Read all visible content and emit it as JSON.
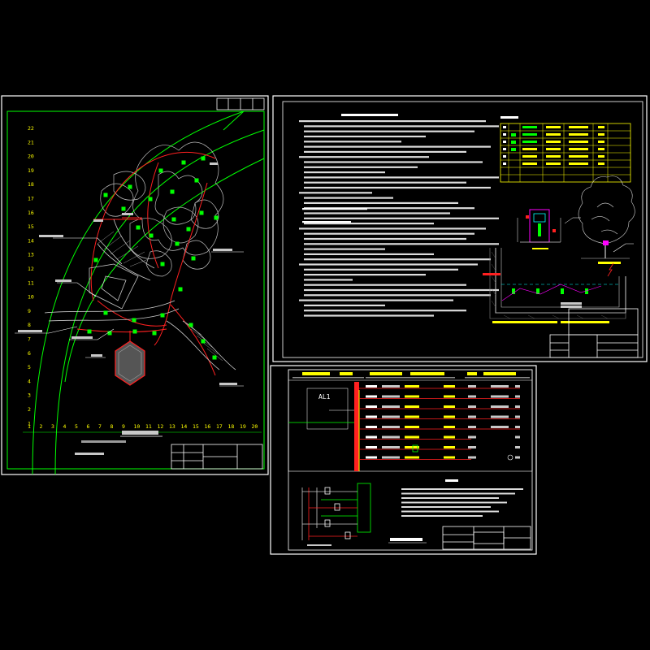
{
  "app": {
    "title": ""
  },
  "colors": {
    "background": "#000000",
    "frame": "#ffffff",
    "green": "#00ff00",
    "red": "#ff2020",
    "yellow": "#ffff00",
    "magenta": "#ff00ff",
    "cyan": "#00ffff",
    "grey": "#c8c8c8"
  },
  "sheet_left": {
    "grid_numbers_left": [
      "22",
      "21",
      "20",
      "19",
      "18",
      "17",
      "16",
      "15",
      "14",
      "13",
      "12",
      "11",
      "10",
      "9",
      "8",
      "7",
      "6",
      "5",
      "4",
      "3",
      "2",
      "1"
    ],
    "grid_numbers_bottom": [
      "1",
      "2",
      "3",
      "4",
      "5",
      "6",
      "7",
      "8",
      "9",
      "10",
      "11",
      "12",
      "13",
      "14",
      "15",
      "16",
      "17",
      "18",
      "19",
      "20"
    ],
    "icons": [
      "pavilion-hexagon-icon",
      "tree-cluster-icon",
      "lamp-marker-icon"
    ]
  },
  "sheet_right_top": {
    "table_rows": 8,
    "table_cols": 6,
    "icons": [
      "tree-elevation-icon",
      "light-fixture-detail-icon",
      "pool-section-icon"
    ]
  },
  "sheet_bottom": {
    "circuit_labels": [
      "AL1"
    ],
    "icons": [
      "distribution-panel-icon",
      "control-circuit-icon"
    ]
  }
}
